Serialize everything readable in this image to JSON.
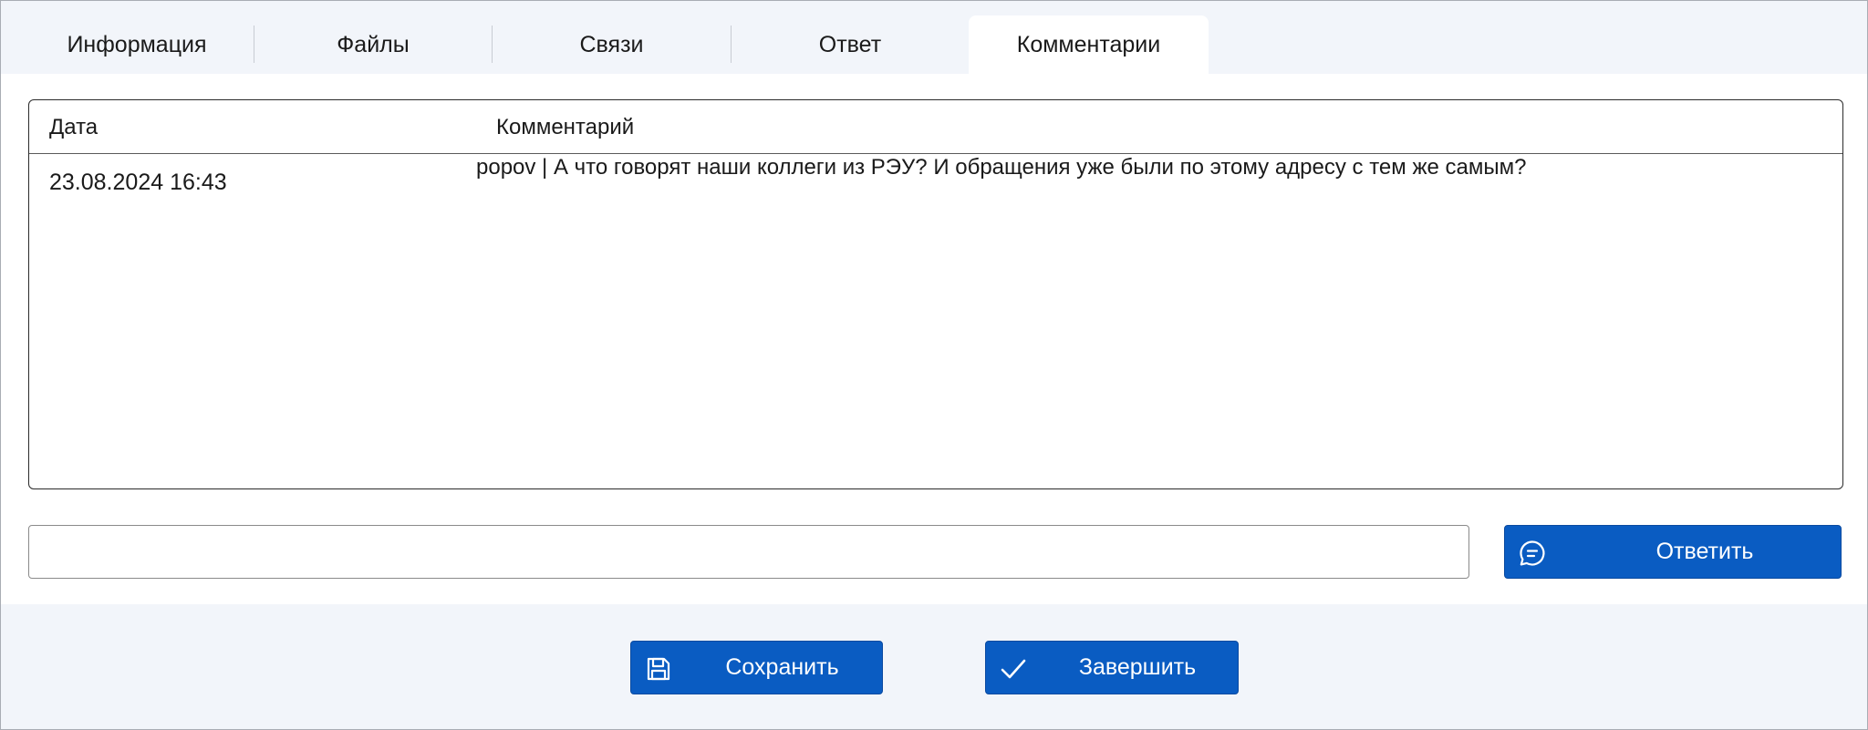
{
  "tabs": [
    {
      "label": "Информация",
      "active": false
    },
    {
      "label": "Файлы",
      "active": false
    },
    {
      "label": "Связи",
      "active": false
    },
    {
      "label": "Ответ",
      "active": false
    },
    {
      "label": "Комментарии",
      "active": true
    }
  ],
  "comments_table": {
    "columns": [
      "Дата",
      "Комментарий"
    ],
    "rows": [
      {
        "date": "23.08.2024 16:43",
        "comment": "popov | А что говорят наши коллеги из РЭУ? И обращения уже были по этому адресу с тем же самым?"
      }
    ]
  },
  "reply": {
    "input_value": "",
    "button_label": "Ответить",
    "button_icon": "chat-bubble-icon"
  },
  "footer": {
    "save_label": "Сохранить",
    "save_icon": "floppy-disk-icon",
    "finish_label": "Завершить",
    "finish_icon": "checkmark-icon"
  },
  "colors": {
    "accent": "#0a5cc2",
    "background": "#f2f5fa",
    "panel": "#ffffff"
  }
}
